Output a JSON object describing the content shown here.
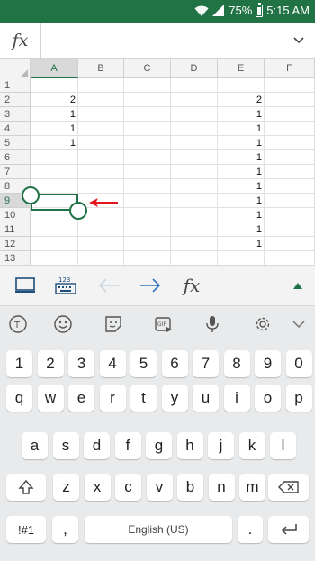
{
  "status_bar": {
    "battery_text": "75%",
    "time": "5:15 AM",
    "background": "#217346"
  },
  "formula_bar": {
    "fx_label": "fx",
    "value": "",
    "expand_icon": "chevron-down-icon"
  },
  "sheet": {
    "columns": [
      "A",
      "B",
      "C",
      "D",
      "E",
      "F"
    ],
    "selected_column": "A",
    "selected_row": "9",
    "rows": [
      {
        "num": "1",
        "A": "",
        "E": ""
      },
      {
        "num": "2",
        "A": "2",
        "E": "2"
      },
      {
        "num": "3",
        "A": "1",
        "E": "1"
      },
      {
        "num": "4",
        "A": "1",
        "E": "1"
      },
      {
        "num": "5",
        "A": "1",
        "E": "1"
      },
      {
        "num": "6",
        "A": "",
        "E": "1"
      },
      {
        "num": "7",
        "A": "",
        "E": "1"
      },
      {
        "num": "8",
        "A": "",
        "E": "1"
      },
      {
        "num": "9",
        "A": "",
        "E": "1"
      },
      {
        "num": "10",
        "A": "",
        "E": "1"
      },
      {
        "num": "11",
        "A": "",
        "E": "1"
      },
      {
        "num": "12",
        "A": "",
        "E": "1"
      },
      {
        "num": "13",
        "A": "",
        "E": ""
      }
    ]
  },
  "toolbar": {
    "fx_label": "fx",
    "items": [
      "screen-icon",
      "keyboard-123-icon",
      "arrow-left-icon",
      "arrow-right-icon",
      "fx-icon",
      "collapse-up-icon"
    ],
    "accent": "#217346"
  },
  "keyboard": {
    "tool_icons": [
      "text-cursor-icon",
      "emoji-icon",
      "sticker-icon",
      "gif-icon",
      "microphone-icon",
      "settings-icon",
      "chevron-down-icon"
    ],
    "gif_label": "GIF",
    "row_numbers": [
      "1",
      "2",
      "3",
      "4",
      "5",
      "6",
      "7",
      "8",
      "9",
      "0"
    ],
    "row_1": [
      "q",
      "w",
      "e",
      "r",
      "t",
      "y",
      "u",
      "i",
      "o",
      "p"
    ],
    "row_2": [
      "a",
      "s",
      "d",
      "f",
      "g",
      "h",
      "j",
      "k",
      "l"
    ],
    "row_3": [
      "z",
      "x",
      "c",
      "v",
      "b",
      "n",
      "m"
    ],
    "symbols_label": "!#1",
    "comma": ",",
    "space_label": "English (US)",
    "period": "."
  }
}
